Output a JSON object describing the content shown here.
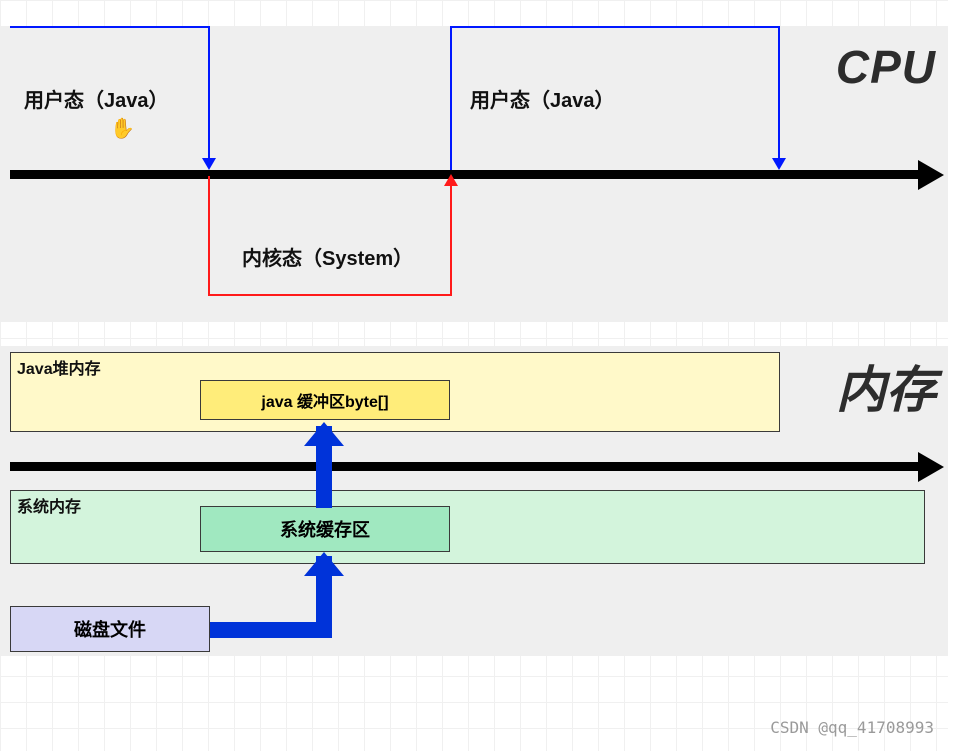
{
  "cpu": {
    "title": "CPU",
    "user_state_1": "用户态（Java）",
    "user_state_2": "用户态（Java）",
    "kernel_state": "内核态（System）"
  },
  "memory": {
    "title": "内存",
    "heap_label": "Java堆内存",
    "heap_buffer": "java 缓冲区byte[]",
    "sys_label": "系统内存",
    "sys_buffer": "系统缓存区",
    "disk": "磁盘文件"
  },
  "watermark": "CSDN @qq_41708993"
}
